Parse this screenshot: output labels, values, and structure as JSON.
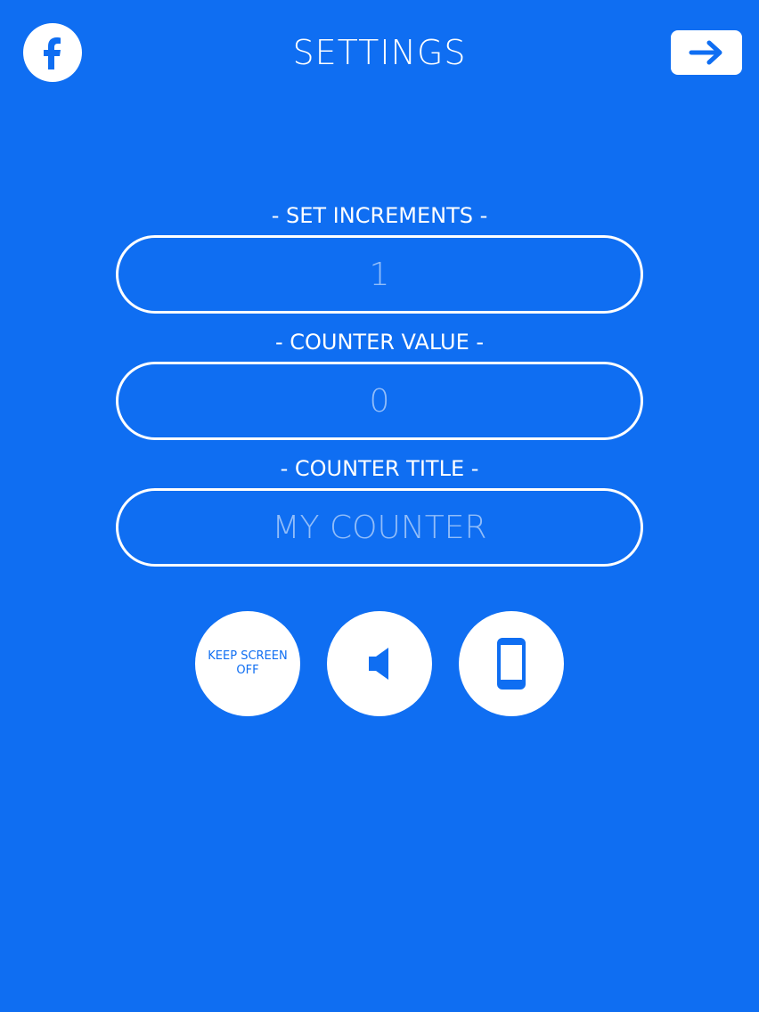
{
  "header": {
    "title": "SETTINGS",
    "facebook_icon": "facebook-icon",
    "next_icon": "arrow-right-icon"
  },
  "fields": {
    "increments": {
      "label": "- SET INCREMENTS -",
      "placeholder": "1"
    },
    "counter_value": {
      "label": "- COUNTER VALUE -",
      "placeholder": "0"
    },
    "counter_title": {
      "label": "- COUNTER TITLE -",
      "placeholder": "MY COUNTER"
    }
  },
  "toggles": {
    "keep_screen": "KEEP SCREEN OFF",
    "sound_icon": "speaker-icon",
    "vibrate_icon": "phone-icon"
  },
  "colors": {
    "background": "#0f6ef2",
    "foreground": "#ffffff"
  }
}
